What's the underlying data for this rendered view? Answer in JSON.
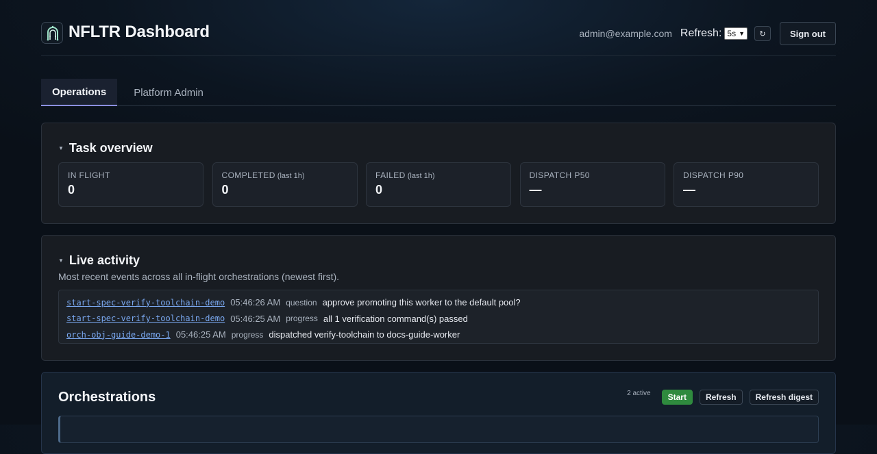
{
  "header": {
    "title": "NFLTR Dashboard",
    "user_email": "admin@example.com",
    "refresh_label": "Refresh:",
    "refresh_interval": "5s",
    "refresh_now_icon": "↻",
    "sign_out_label": "Sign out"
  },
  "tabs": [
    {
      "label": "Operations",
      "active": true
    },
    {
      "label": "Platform Admin",
      "active": false
    }
  ],
  "task_overview": {
    "title": "Task overview",
    "stats": [
      {
        "label": "IN FLIGHT",
        "sub": "",
        "value": "0"
      },
      {
        "label": "COMPLETED",
        "sub": "(last 1h)",
        "value": "0"
      },
      {
        "label": "FAILED",
        "sub": "(last 1h)",
        "value": "0"
      },
      {
        "label": "DISPATCH P50",
        "sub": "",
        "value": "—"
      },
      {
        "label": "DISPATCH P90",
        "sub": "",
        "value": "—"
      }
    ]
  },
  "live_activity": {
    "title": "Live activity",
    "description": "Most recent events across all in-flight orchestrations (newest first).",
    "events": [
      {
        "orchestration": "start-spec-verify-toolchain-demo",
        "time": "05:46:26 AM",
        "kind": "question",
        "message": "approve promoting this worker to the default pool?"
      },
      {
        "orchestration": "start-spec-verify-toolchain-demo",
        "time": "05:46:25 AM",
        "kind": "progress",
        "message": "all 1 verification command(s) passed"
      },
      {
        "orchestration": "orch-obj-guide-demo-1",
        "time": "05:46:25 AM",
        "kind": "progress",
        "message": "dispatched verify-toolchain to docs-guide-worker"
      }
    ]
  },
  "orchestrations": {
    "title": "Orchestrations",
    "active_count": "2 active",
    "start_label": "Start",
    "refresh_label": "Refresh",
    "refresh_digest_label": "Refresh digest"
  },
  "colors": {
    "accent": "#8b8fe0",
    "link": "#7aa8f0",
    "start_button": "#2f8a3e"
  }
}
